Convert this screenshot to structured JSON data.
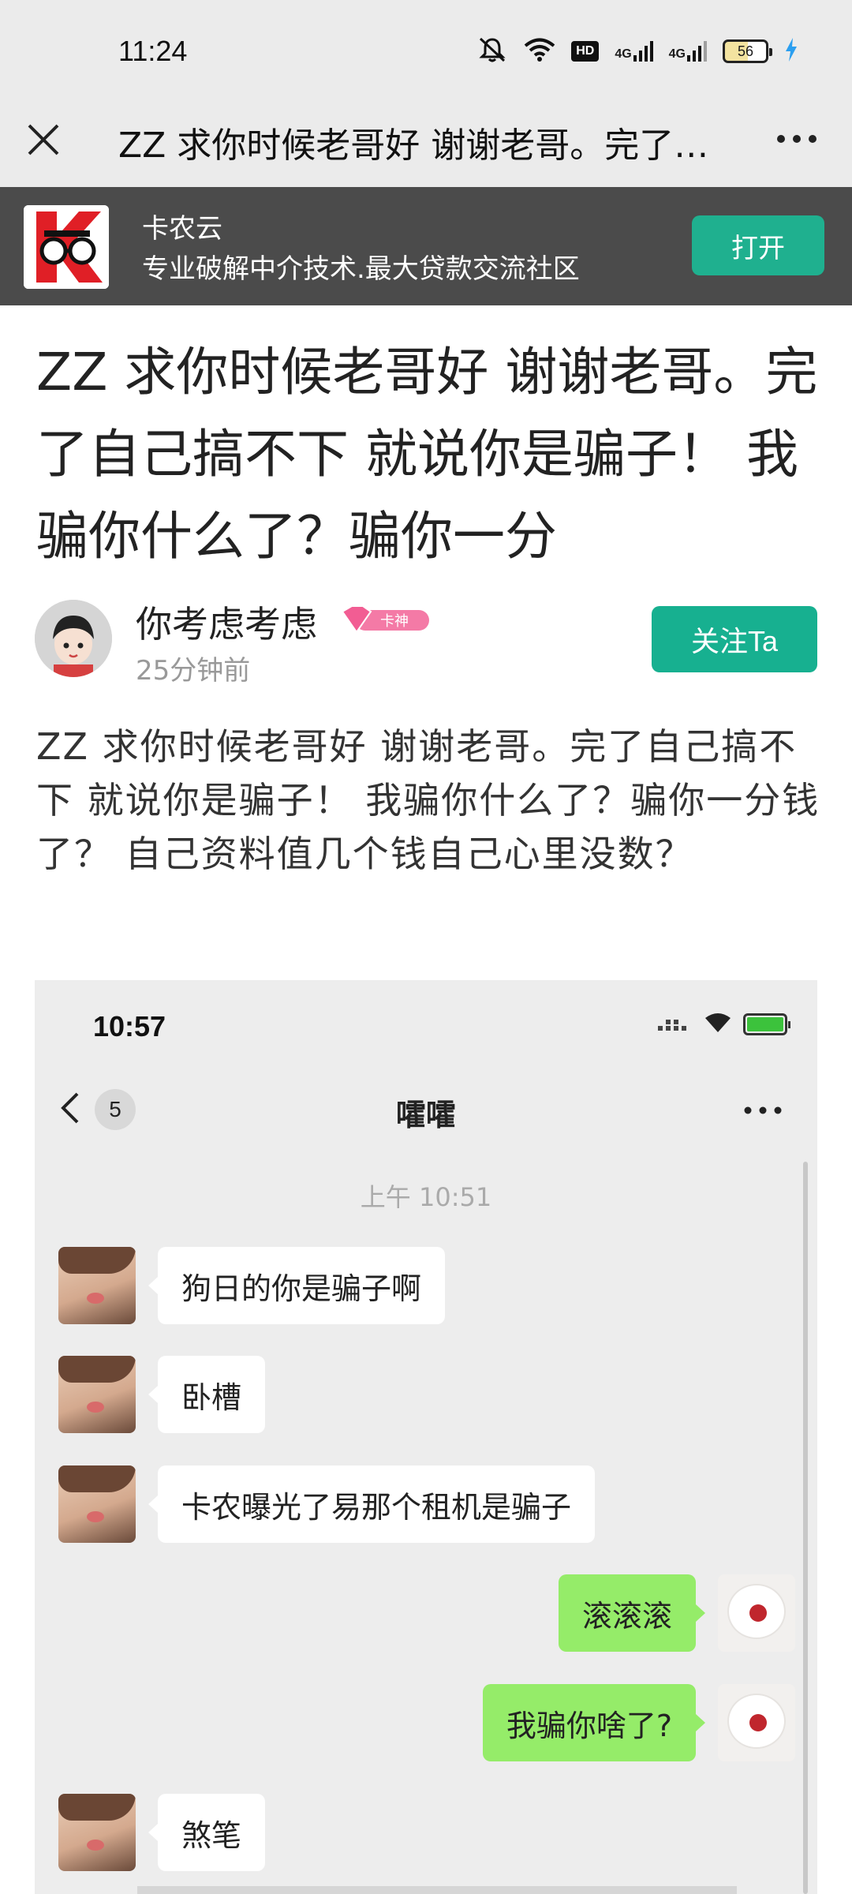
{
  "status_bar": {
    "time": "11:24",
    "network_1": "4G",
    "network_2": "4G",
    "hd_label": "HD",
    "battery": "56",
    "icons": [
      "mute-icon",
      "wifi-icon",
      "hd-icon",
      "signal-icon",
      "signal-icon",
      "battery-icon",
      "charging-icon"
    ]
  },
  "nav": {
    "title": "ZZ 求你时候老哥好 谢谢老哥。完了…",
    "close_icon": "close-icon",
    "more_icon": "more-icon"
  },
  "app_banner": {
    "name": "卡农云",
    "tagline": "专业破解中介技术.最大贷款交流社区",
    "open_label": "打开",
    "accent": "#1fb08f"
  },
  "post": {
    "title": "ZZ 求你时候老哥好 谢谢老哥。完了自己搞不下 就说你是骗子！ 我骗你什么了？骗你一分",
    "author": "你考虑考虑",
    "rank_badge": "卡神",
    "time": "25分钟前",
    "follow_label": "关注Ta",
    "body": "ZZ 求你时候老哥好 谢谢老哥。完了自己搞不下 就说你是骗子！ 我骗你什么了？骗你一分钱了？ 自己资料值几个钱自己心里没数？"
  },
  "screenshot": {
    "time": "10:57",
    "unread_count": "5",
    "chat_title": "嚯嚯",
    "timestamp": "上午 10:51",
    "messages": [
      {
        "side": "left",
        "text": "狗日的你是骗子啊"
      },
      {
        "side": "left",
        "text": "卧槽"
      },
      {
        "side": "left",
        "text": "卡农曝光了易那个租机是骗子"
      },
      {
        "side": "right",
        "text": "滚滚滚"
      },
      {
        "side": "right",
        "text": "我骗你啥了?"
      },
      {
        "side": "left",
        "text": "煞笔"
      }
    ],
    "bubble_colors": {
      "self": "#95ec69",
      "other": "#ffffff"
    }
  }
}
